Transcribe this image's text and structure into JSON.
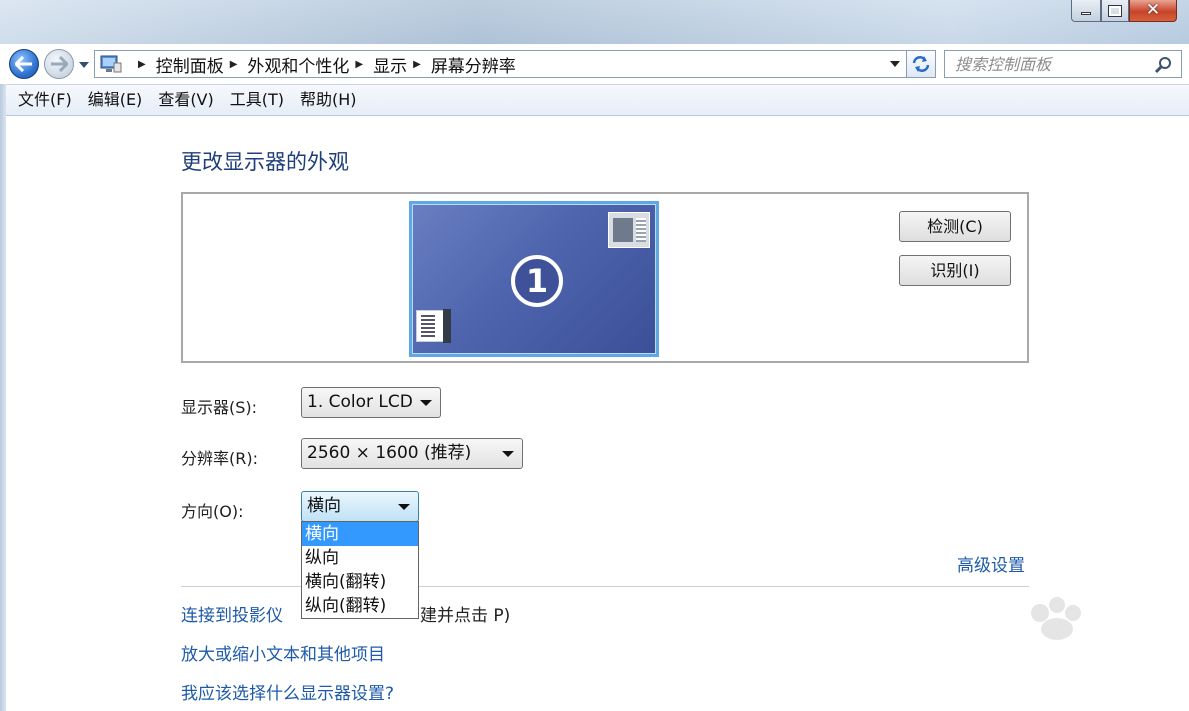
{
  "window": {
    "minimize": "—",
    "maximize": "□",
    "close": "✕"
  },
  "nav": {
    "back_icon": "back-arrow-icon",
    "forward_icon": "forward-arrow-icon",
    "breadcrumbs": [
      "控制面板",
      "外观和个性化",
      "显示",
      "屏幕分辨率"
    ],
    "search_placeholder": "搜索控制面板"
  },
  "menu": [
    "文件(F)",
    "编辑(E)",
    "查看(V)",
    "工具(T)",
    "帮助(H)"
  ],
  "main": {
    "title": "更改显示器的外观",
    "monitor_number": "1",
    "detect_button": "检测(C)",
    "identify_button": "识别(I)",
    "display_label": "显示器(S):",
    "display_value": "1. Color LCD",
    "resolution_label": "分辨率(R):",
    "resolution_value": "2560 × 1600 (推荐)",
    "orientation_label": "方向(O):",
    "orientation_value": "横向",
    "orientation_options": [
      "横向",
      "纵向",
      "横向(翻转)",
      "纵向(翻转)"
    ],
    "advanced_link": "高级设置",
    "link_projector": "连接到投影仪",
    "link_projector_hint": "建并点击 P)",
    "link_resize": "放大或缩小文本和其他项目",
    "link_which": "我应该选择什么显示器设置?"
  },
  "colors": {
    "link": "#1e5aa8",
    "title": "#1f3f7a",
    "selection": "#3399ff"
  }
}
